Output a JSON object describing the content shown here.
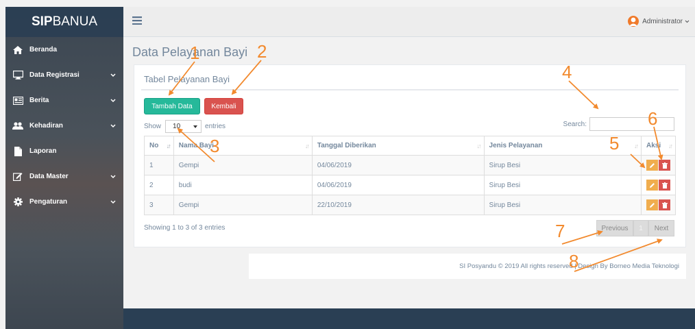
{
  "sidebar": {
    "brand_bold": "SIP",
    "brand_rest": "BANUA",
    "items": [
      {
        "label": "Beranda",
        "icon": "home-icon",
        "has_children": false
      },
      {
        "label": "Data Registrasi",
        "icon": "monitor-icon",
        "has_children": true
      },
      {
        "label": "Berita",
        "icon": "newspaper-icon",
        "has_children": true
      },
      {
        "label": "Kehadiran",
        "icon": "users-icon",
        "has_children": true
      },
      {
        "label": "Laporan",
        "icon": "file-icon",
        "has_children": false
      },
      {
        "label": "Data Master",
        "icon": "edit-icon",
        "has_children": true
      },
      {
        "label": "Pengaturan",
        "icon": "gear-icon",
        "has_children": true
      }
    ]
  },
  "topbar": {
    "user_name": "Administrator",
    "menu_icon": "hamburger-icon"
  },
  "page": {
    "title": "Data Pelayanan Bayi",
    "panel_title": "Tabel Pelayanan Bayi",
    "add_button": "Tambah Data",
    "back_button": "Kembali",
    "show_label": "Show",
    "entries_label": "entries",
    "page_length": "10",
    "search_label": "Search:",
    "search_value": ""
  },
  "table": {
    "columns": [
      "No",
      "Nama Bayi",
      "Tanggal Diberikan",
      "Jenis Pelayanan",
      "Aksi"
    ],
    "rows": [
      {
        "no": "1",
        "nama": "Gempi",
        "tanggal": "04/06/2019",
        "jenis": "Sirup Besi"
      },
      {
        "no": "2",
        "nama": "budi",
        "tanggal": "04/06/2019",
        "jenis": "Sirup Besi"
      },
      {
        "no": "3",
        "nama": "Gempi",
        "tanggal": "22/10/2019",
        "jenis": "Sirup Besi"
      }
    ]
  },
  "pagination": {
    "info": "Showing 1 to 3 of 3 entries",
    "previous": "Previous",
    "current": "1",
    "next": "Next"
  },
  "footer": {
    "text": "SI Posyandu © 2019 All rights reserved | Design By Borneo Media Teknologi"
  },
  "annotations": [
    "1",
    "2",
    "3",
    "4",
    "5",
    "6",
    "7",
    "8"
  ],
  "colors": {
    "annotation": "#f28a2e",
    "sidebar_dark": "#2a3f54",
    "success": "#26b99a",
    "danger": "#d9534f",
    "warning": "#f0ad4e"
  }
}
